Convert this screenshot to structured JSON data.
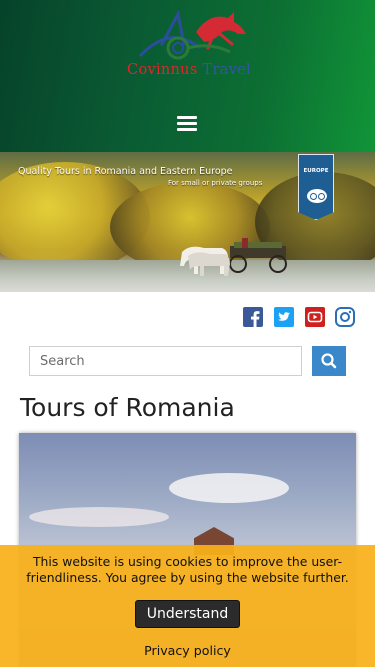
{
  "header": {
    "brand_word1": "Covinnus",
    "brand_word2": "Travel",
    "menu_icon": "hamburger-menu-icon"
  },
  "hero": {
    "headline": "Quality Tours in Romania and Eastern Europe",
    "subline": "For small or private groups"
  },
  "social": [
    {
      "name": "facebook",
      "icon": "facebook-icon",
      "color": "#3b5998"
    },
    {
      "name": "twitter",
      "icon": "twitter-icon",
      "color": "#1da1f2"
    },
    {
      "name": "youtube",
      "icon": "youtube-icon",
      "color": "#cd201f"
    },
    {
      "name": "instagram",
      "icon": "instagram-icon",
      "color": "#2a6fb6"
    }
  ],
  "search": {
    "placeholder": "Search",
    "button_icon": "search-icon"
  },
  "page": {
    "title": "Tours of Romania"
  },
  "cookie": {
    "message": "This website is using cookies to improve the user-friendliness. You agree by using the website further.",
    "accept_label": "Understand",
    "policy_label": "Privacy policy"
  },
  "colors": {
    "header_dark": "#06432a",
    "header_light": "#119538",
    "cookie_bg": "#f9b01a",
    "search_button": "#3a87c9"
  }
}
